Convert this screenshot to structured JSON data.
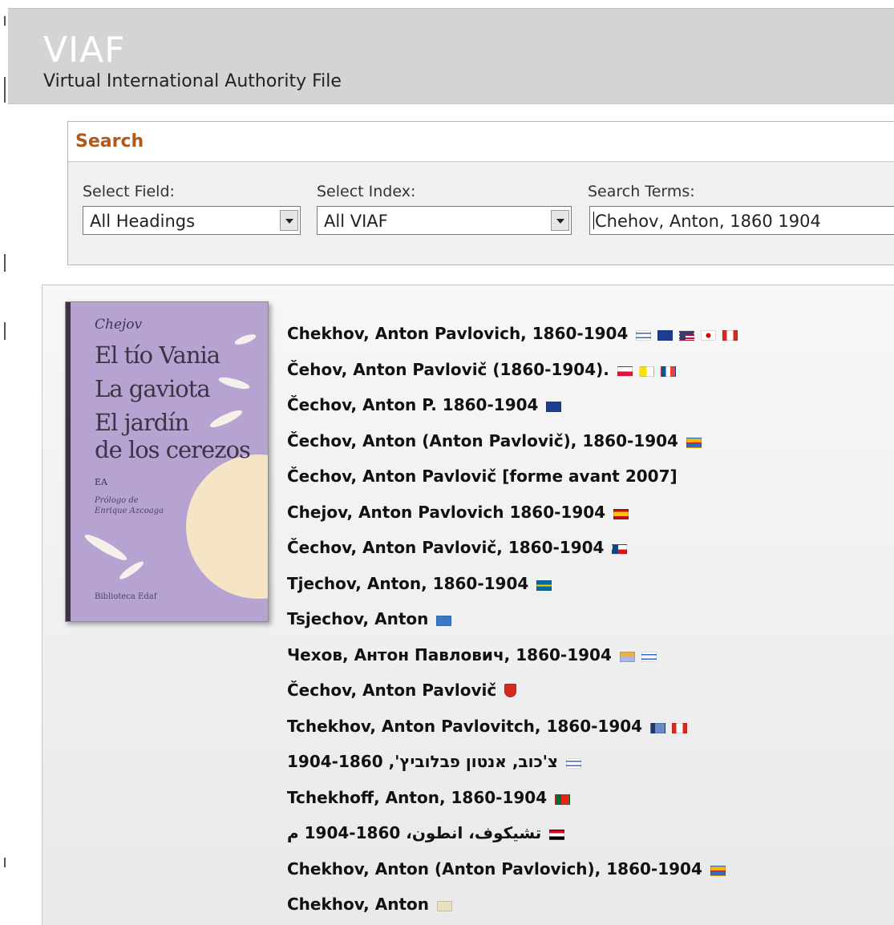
{
  "app": {
    "logo": "VIAF",
    "tagline": "Virtual International Authority File"
  },
  "search": {
    "title": "Search",
    "field_label": "Select Field:",
    "field_value": "All Headings",
    "index_label": "Select Index:",
    "index_value": "All VIAF",
    "terms_label": "Search Terms:",
    "terms_value": "Chehov, Anton, 1860 1904"
  },
  "cover": {
    "author": "Chejov",
    "title_lines": [
      "El tío Vania",
      "La gaviota",
      "El jardín",
      "de los cerezos"
    ],
    "publisher_mark": "EA",
    "prologue": "Prólogo de\nEnrique Azcoaga",
    "series": "Biblioteca Edaf"
  },
  "results": [
    {
      "text": "Chekhov, Anton Pavlovich, 1860-1904",
      "sources": [
        "israel-flag-icon",
        "australia-flag-icon",
        "usa-flag-icon",
        "japan-flag-icon",
        "canada-flag-icon"
      ]
    },
    {
      "text": "Čehov, Anton Pavlovič (1860-1904).",
      "sources": [
        "poland-flag-icon",
        "vatican-flag-icon",
        "france-flag-icon"
      ]
    },
    {
      "text": "Čechov, Anton P. 1860-1904",
      "sources": [
        "dnb-icon"
      ]
    },
    {
      "text": "Čechov, Anton (Anton Pavlovič), 1860-1904",
      "sources": [
        "catalonia-library-icon"
      ]
    },
    {
      "text": "Čechov, Anton Pavlovič [forme avant 2007]",
      "sources": [
        "rero-icon"
      ]
    },
    {
      "text": "Chejov, Anton Pavlovich 1860-1904",
      "sources": [
        "spain-flag-icon"
      ]
    },
    {
      "text": "Čechov, Anton Pavlovič, 1860-1904",
      "sources": [
        "czech-flag-icon"
      ]
    },
    {
      "text": "Tjechov, Anton, 1860-1904",
      "sources": [
        "sweden-flag-icon"
      ]
    },
    {
      "text": "Tsjechov, Anton",
      "sources": [
        "flacc-icon"
      ]
    },
    {
      "text": "Чехов, Антон Павлович, 1860-1904",
      "sources": [
        "library-building-icon",
        "israel-flag-icon"
      ]
    },
    {
      "text": "Čechov, Anton Pavlovič",
      "sources": [
        "switzerland-shield-icon"
      ]
    },
    {
      "text": "Tchekhov, Anton Pavlovitch, 1860-1904",
      "sources": [
        "book-icon",
        "canada-flag-icon"
      ]
    },
    {
      "text": "צ'כוב, אנטון פבלוביץ', 1904-1860",
      "sources": [
        "israel-flag-icon"
      ]
    },
    {
      "text": "Tchekhoff, Anton, 1860-1904",
      "sources": [
        "portugal-flag-icon"
      ]
    },
    {
      "text": "تشيكوف، انطون، 1860-1904 م",
      "sources": [
        "egypt-flag-icon"
      ]
    },
    {
      "text": "Chekhov, Anton (Anton Pavlovich), 1860-1904",
      "sources": [
        "catalonia-library-icon"
      ]
    },
    {
      "text": "Chekhov, Anton",
      "sources": [
        "wikipedia-icon"
      ]
    }
  ],
  "colors": {
    "header_bg": "#d4d4d4",
    "search_title": "#b0591a",
    "heading_text": "#111111"
  }
}
